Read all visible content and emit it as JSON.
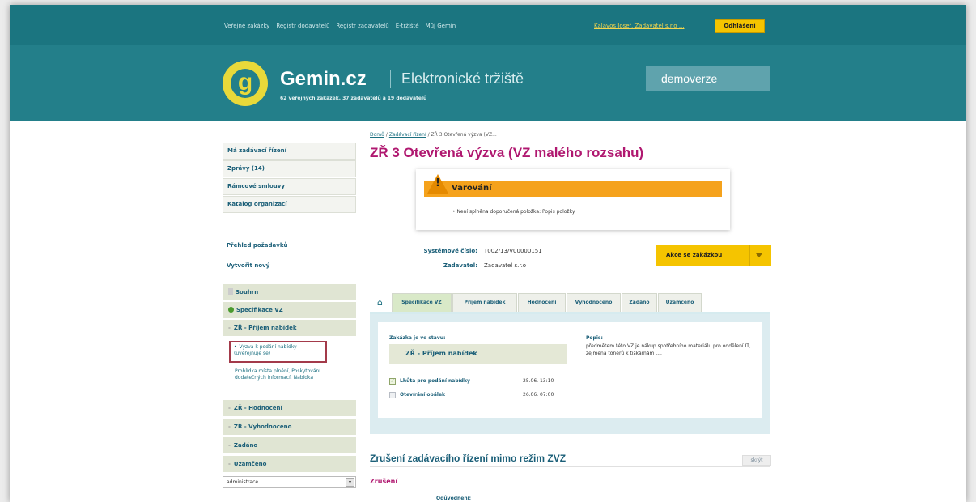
{
  "topnav": {
    "items": [
      "Veřejné zakázky",
      "Registr dodavatelů",
      "Registr zadavatelů",
      "E-tržiště",
      "Můj Gemin"
    ],
    "user": "Kalavos Josef, Zadavatel s.r.o ...",
    "logout": "Odhlášení"
  },
  "header": {
    "logo_letter": "g",
    "brand": "Gemin.cz",
    "subtitle": "Elektronické tržiště",
    "stats": "62 veřejných zakázek, 37 zadavatelů a 19 dodavatelů",
    "badge": "demoverze"
  },
  "breadcrumb": {
    "home": "Domů",
    "sep": "/",
    "section": "Zadávací řízení",
    "current": "ZŘ 3 Otevřená výzva (VZ..."
  },
  "page_title": "ZŘ 3 Otevřená výzva (VZ malého rozsahu)",
  "sidebar": {
    "main_items": [
      "Má zadávací řízení",
      "Zprávy (14)",
      "Rámcové smlouvy",
      "Katalog organizací"
    ],
    "overview_link": "Přehled požadavků",
    "create_link": "Vytvořit nový",
    "phases": {
      "summary": "Souhrn",
      "spec": "Specifikace VZ",
      "receipt": "ZŘ - Příjem nabídek",
      "evaluation": "ZŘ - Hodnocení",
      "result": "ZŘ - Vyhodnoceno",
      "awarded": "Zadáno",
      "closed": "Uzamčeno"
    },
    "sub_active": "Výzva k podání nabídky (uveřejňuje se)",
    "sub_other": "Prohlídka místa plnění, Poskytování dodatečných informací, Nabídka",
    "admin_select": "administrace",
    "marker": "-",
    "bullet": "•",
    "select_arrow": "▾"
  },
  "warning": {
    "icon": "!",
    "title": "Varování",
    "message": "• Není splněna doporučená položka: Popis položky"
  },
  "meta": {
    "system_label": "Systémové číslo:",
    "system_value": "T002/13/V00000151",
    "buyer_label": "Zadavatel:",
    "buyer_value": "Zadavatel s.r.o"
  },
  "action_button": "Akce se zakázkou",
  "tabs": {
    "home_icon": "⌂",
    "spec": "Specifikace VZ",
    "receipt": "Příjem nabídek",
    "evaluation": "Hodnocení",
    "result": "Vyhodnoceno",
    "awarded": "Zadáno",
    "closed": "Uzamčeno"
  },
  "status": {
    "label": "Zakázka je ve stavu:",
    "value": "ZŘ - Příjem nabídek",
    "desc_label": "Popis:",
    "desc_text": "předmětem této VZ je nákup spotřebního materiálu pro oddělení IT, zejména tonerů k tiskárnám ....",
    "deadlines": {
      "submit_name": "Lhůta pro podání nabídky",
      "submit_date": "25.06. 13:10",
      "open_name": "Otevírání obálek",
      "open_date": "26.06. 07:00"
    },
    "check_mark": "✓"
  },
  "cancel": {
    "title": "Zrušení zadávacího řízení mimo režim ZVZ",
    "hide": "skrýt",
    "subtitle": "Zrušení",
    "reason_label": "Odůvodnění:"
  }
}
